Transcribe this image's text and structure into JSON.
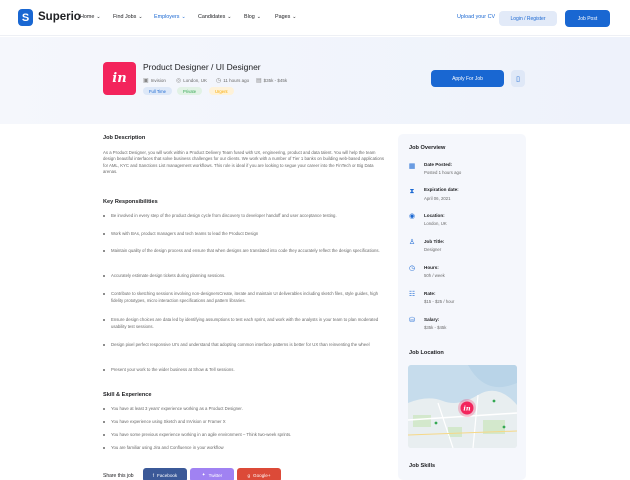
{
  "header": {
    "brand": "Superio",
    "nav": [
      {
        "label": "Home",
        "active": false
      },
      {
        "label": "Find Jobs",
        "active": false
      },
      {
        "label": "Employers",
        "active": true
      },
      {
        "label": "Candidates",
        "active": false
      },
      {
        "label": "Blog",
        "active": false
      },
      {
        "label": "Pages",
        "active": false
      }
    ],
    "upload_cv": "Upload your CV",
    "login": "Login / Register",
    "job_post": "Job Post"
  },
  "job": {
    "logo_text": "in",
    "title": "Product Designer / UI Designer",
    "company": "Invision",
    "location": "London, UK",
    "posted": "11 hours ago",
    "salary": "$35k - $45k",
    "tags": [
      "Full Time",
      "Private",
      "Urgent"
    ],
    "apply": "Apply For Job"
  },
  "description": {
    "heading": "Job Description",
    "text": "As a Product Designer, you will work within a Product Delivery Team fused with UX, engineering, product and data talent. You will help the team design beautiful interfaces that solve business challenges for our clients. We work with a number of Tier 1 banks on building web-based applications for AML, KYC and Sanctions List management workflows. This role is ideal if you are looking to segue your career into the FinTech or Big Data arenas."
  },
  "responsibilities": {
    "heading": "Key Responsibilities",
    "items": [
      "Be involved in every step of the product design cycle from discovery to developer handoff and user acceptance testing.",
      "Work with BAs, product managers and tech teams to lead the Product Design",
      "Maintain quality of the design process and ensure that when designs are translated into code they accurately reflect the design specifications.",
      "Accurately estimate design tickets during planning sessions.",
      "Contribute to sketching sessions involving non-designersCreate, iterate and maintain UI deliverables including sketch files, style guides, high fidelity prototypes, micro interaction specifications and pattern libraries.",
      "Ensure design choices are data led by identifying assumptions to test each sprint, and work with the analysts in your team to plan moderated usability test sessions.",
      "Design pixel perfect responsive UI's and understand that adopting common interface patterns is better for UX than reinventing the wheel",
      "Present your work to the wider business at Show & Tell sessions."
    ]
  },
  "skills": {
    "heading": "Skill & Experience",
    "items": [
      "You have at least 3 years' experience working as a Product Designer.",
      "You have experience using Sketch and InVision or Framer X",
      "You have some previous experience working in an agile environment – Think two-week sprints.",
      "You are familiar using Jira and Confluence in your workflow"
    ]
  },
  "share": {
    "label": "Share this job",
    "facebook": "Facebook",
    "twitter": "Twitter",
    "google": "Google+"
  },
  "overview": {
    "heading": "Job Overview",
    "items": [
      {
        "label": "Date Posted:",
        "value": "Posted 1 hours ago",
        "icon": "calendar-icon"
      },
      {
        "label": "Expiration date:",
        "value": "April 06, 2021",
        "icon": "hourglass-icon"
      },
      {
        "label": "Location:",
        "value": "London, UK",
        "icon": "location-icon"
      },
      {
        "label": "Job Title:",
        "value": "Designer",
        "icon": "user-icon"
      },
      {
        "label": "Hours:",
        "value": "50h / week",
        "icon": "clock-icon"
      },
      {
        "label": "Rate:",
        "value": "$15 - $25 / hour",
        "icon": "rate-icon"
      },
      {
        "label": "Salary:",
        "value": "$35k - $45k",
        "icon": "salary-icon"
      }
    ]
  },
  "location_section": {
    "heading": "Job Location"
  },
  "skills_section": {
    "heading": "Job Skills"
  },
  "colors": {
    "primary": "#1967d2",
    "brand_logo": "#f3245c",
    "facebook": "#3b5998",
    "twitter": "#a082f2",
    "google": "#dc4a38"
  }
}
